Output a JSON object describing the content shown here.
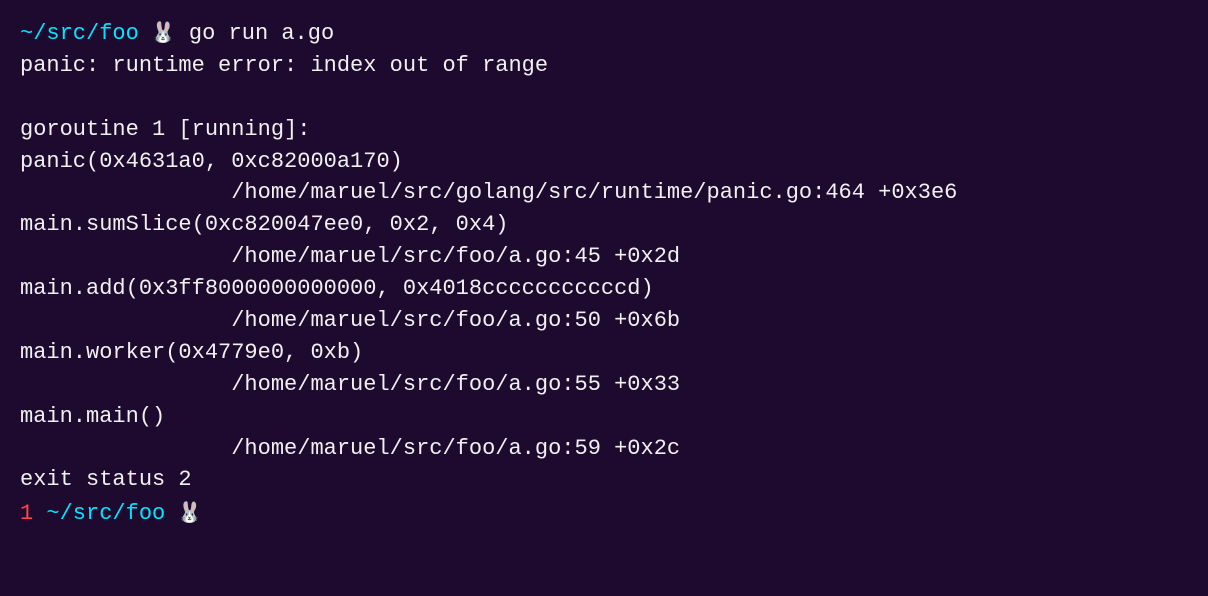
{
  "terminal": {
    "bg_color": "#1e0a2e",
    "lines": [
      {
        "type": "prompt",
        "path": "~/src/foo",
        "rabbit": "🐰",
        "command": " go run a.go"
      },
      {
        "type": "text",
        "content": "panic: runtime error: index out of range"
      },
      {
        "type": "blank"
      },
      {
        "type": "text",
        "content": "goroutine 1 [running]:"
      },
      {
        "type": "text",
        "content": "panic(0x4631a0, 0xc82000a170)"
      },
      {
        "type": "text",
        "content": "\t\t/home/maruel/src/golang/src/runtime/panic.go:464 +0x3e6"
      },
      {
        "type": "text",
        "content": "main.sumSlice(0xc820047ee0, 0x2, 0x4)"
      },
      {
        "type": "text",
        "content": "\t\t/home/maruel/src/foo/a.go:45 +0x2d"
      },
      {
        "type": "text",
        "content": "main.add(0x3ff8000000000000, 0x4018cccccccccccd)"
      },
      {
        "type": "text",
        "content": "\t\t/home/maruel/src/foo/a.go:50 +0x6b"
      },
      {
        "type": "text",
        "content": "main.worker(0x4779e0, 0xb)"
      },
      {
        "type": "text",
        "content": "\t\t/home/maruel/src/foo/a.go:55 +0x33"
      },
      {
        "type": "text",
        "content": "main.main()"
      },
      {
        "type": "text",
        "content": "\t\t/home/maruel/src/foo/a.go:59 +0x2c"
      },
      {
        "type": "text",
        "content": "exit status 2"
      },
      {
        "type": "prompt2",
        "num": "1",
        "path": " ~/src/foo",
        "rabbit": "🐰"
      }
    ]
  }
}
